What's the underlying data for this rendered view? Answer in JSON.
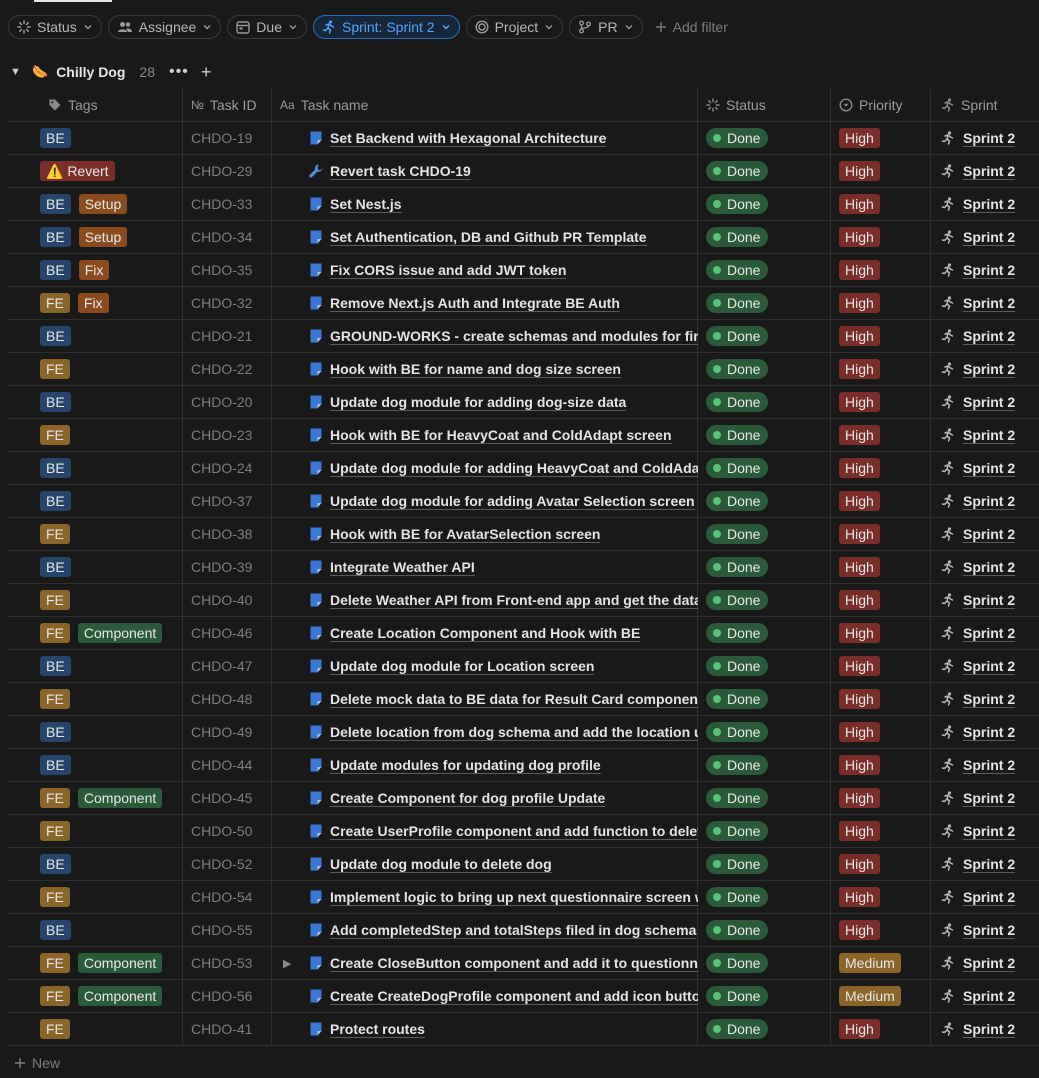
{
  "filters": {
    "status": "Status",
    "assignee": "Assignee",
    "due": "Due",
    "sprint": "Sprint: Sprint 2",
    "project": "Project",
    "pr": "PR",
    "add_filter": "Add filter"
  },
  "group": {
    "emoji": "🌭",
    "name": "Chilly Dog",
    "count": "28",
    "more": "•••",
    "add": "+"
  },
  "columns": {
    "tags": "Tags",
    "task_id": "Task ID",
    "task_id_prefix": "№",
    "task_name": "Task name",
    "task_name_prefix": "Aa",
    "status": "Status",
    "priority": "Priority",
    "sprint": "Sprint"
  },
  "rows": [
    {
      "tags": [
        "BE"
      ],
      "id": "CHDO-19",
      "name": "Set Backend with Hexagonal Architecture",
      "icon": "task",
      "status": "Done",
      "priority": "High",
      "sprint": "Sprint 2"
    },
    {
      "tags": [
        "⚠️ Revert"
      ],
      "id": "CHDO-29",
      "name": "Revert task CHDO-19",
      "icon": "wrench",
      "status": "Done",
      "priority": "High",
      "sprint": "Sprint 2"
    },
    {
      "tags": [
        "BE",
        "Setup"
      ],
      "id": "CHDO-33",
      "name": "Set Nest.js",
      "icon": "task",
      "status": "Done",
      "priority": "High",
      "sprint": "Sprint 2"
    },
    {
      "tags": [
        "BE",
        "Setup"
      ],
      "id": "CHDO-34",
      "name": "Set Authentication, DB and Github PR Template",
      "icon": "task",
      "status": "Done",
      "priority": "High",
      "sprint": "Sprint 2"
    },
    {
      "tags": [
        "BE",
        "Fix"
      ],
      "id": "CHDO-35",
      "name": "Fix CORS issue and add JWT token",
      "icon": "task",
      "status": "Done",
      "priority": "High",
      "sprint": "Sprint 2"
    },
    {
      "tags": [
        "FE",
        "Fix"
      ],
      "id": "CHDO-32",
      "name": "Remove Next.js Auth and Integrate BE Auth",
      "icon": "task",
      "status": "Done",
      "priority": "High",
      "sprint": "Sprint 2"
    },
    {
      "tags": [
        "BE"
      ],
      "id": "CHDO-21",
      "name": "GROUND-WORKS - create schemas and modules for firs",
      "icon": "task",
      "status": "Done",
      "priority": "High",
      "sprint": "Sprint 2"
    },
    {
      "tags": [
        "FE"
      ],
      "id": "CHDO-22",
      "name": "Hook with BE for name and dog size screen",
      "icon": "task",
      "status": "Done",
      "priority": "High",
      "sprint": "Sprint 2"
    },
    {
      "tags": [
        "BE"
      ],
      "id": "CHDO-20",
      "name": "Update dog module for adding dog-size data",
      "icon": "task",
      "status": "Done",
      "priority": "High",
      "sprint": "Sprint 2"
    },
    {
      "tags": [
        "FE"
      ],
      "id": "CHDO-23",
      "name": "Hook with BE for HeavyCoat and ColdAdapt screen",
      "icon": "task",
      "status": "Done",
      "priority": "High",
      "sprint": "Sprint 2"
    },
    {
      "tags": [
        "BE"
      ],
      "id": "CHDO-24",
      "name": "Update dog module for adding HeavyCoat and ColdAda",
      "icon": "task",
      "status": "Done",
      "priority": "High",
      "sprint": "Sprint 2"
    },
    {
      "tags": [
        "BE"
      ],
      "id": "CHDO-37",
      "name": "Update dog module for adding Avatar Selection screen",
      "icon": "task",
      "status": "Done",
      "priority": "High",
      "sprint": "Sprint 2"
    },
    {
      "tags": [
        "FE"
      ],
      "id": "CHDO-38",
      "name": "Hook with BE for AvatarSelection screen",
      "icon": "task",
      "status": "Done",
      "priority": "High",
      "sprint": "Sprint 2"
    },
    {
      "tags": [
        "BE"
      ],
      "id": "CHDO-39",
      "name": "Integrate Weather API",
      "icon": "task",
      "status": "Done",
      "priority": "High",
      "sprint": "Sprint 2"
    },
    {
      "tags": [
        "FE"
      ],
      "id": "CHDO-40",
      "name": "Delete Weather API from Front-end app and get the data",
      "icon": "task",
      "status": "Done",
      "priority": "High",
      "sprint": "Sprint 2"
    },
    {
      "tags": [
        "FE",
        "Component"
      ],
      "id": "CHDO-46",
      "name": "Create Location Component and Hook with BE",
      "icon": "task",
      "status": "Done",
      "priority": "High",
      "sprint": "Sprint 2"
    },
    {
      "tags": [
        "BE"
      ],
      "id": "CHDO-47",
      "name": "Update dog module for Location screen",
      "icon": "task",
      "status": "Done",
      "priority": "High",
      "sprint": "Sprint 2"
    },
    {
      "tags": [
        "FE"
      ],
      "id": "CHDO-48",
      "name": "Delete mock data to BE data for Result Card component",
      "icon": "task",
      "status": "Done",
      "priority": "High",
      "sprint": "Sprint 2"
    },
    {
      "tags": [
        "BE"
      ],
      "id": "CHDO-49",
      "name": "Delete location from dog schema and add the location u",
      "icon": "task",
      "status": "Done",
      "priority": "High",
      "sprint": "Sprint 2"
    },
    {
      "tags": [
        "BE"
      ],
      "id": "CHDO-44",
      "name": "Update modules for updating dog profile",
      "icon": "task",
      "status": "Done",
      "priority": "High",
      "sprint": "Sprint 2"
    },
    {
      "tags": [
        "FE",
        "Component"
      ],
      "id": "CHDO-45",
      "name": "Create Component for dog profile Update",
      "icon": "task",
      "status": "Done",
      "priority": "High",
      "sprint": "Sprint 2"
    },
    {
      "tags": [
        "FE"
      ],
      "id": "CHDO-50",
      "name": "Create UserProfile component and add function to delet",
      "icon": "task",
      "status": "Done",
      "priority": "High",
      "sprint": "Sprint 2"
    },
    {
      "tags": [
        "BE"
      ],
      "id": "CHDO-52",
      "name": "Update dog module to delete dog",
      "icon": "task",
      "status": "Done",
      "priority": "High",
      "sprint": "Sprint 2"
    },
    {
      "tags": [
        "FE"
      ],
      "id": "CHDO-54",
      "name": "Implement logic to bring up next questionnaire screen w",
      "icon": "task",
      "status": "Done",
      "priority": "High",
      "sprint": "Sprint 2"
    },
    {
      "tags": [
        "BE"
      ],
      "id": "CHDO-55",
      "name": "Add completedStep and totalSteps filed in dog schema",
      "icon": "task",
      "status": "Done",
      "priority": "High",
      "sprint": "Sprint 2"
    },
    {
      "tags": [
        "FE",
        "Component"
      ],
      "id": "CHDO-53",
      "name": "Create CloseButton component and add it to questionna",
      "icon": "task",
      "expand": "▶",
      "status": "Done",
      "priority": "Medium",
      "sprint": "Sprint 2"
    },
    {
      "tags": [
        "FE",
        "Component"
      ],
      "id": "CHDO-56",
      "name": "Create CreateDogProfile component and add icon butto",
      "icon": "task",
      "status": "Done",
      "priority": "Medium",
      "sprint": "Sprint 2"
    },
    {
      "tags": [
        "FE"
      ],
      "id": "CHDO-41",
      "name": "Protect routes",
      "icon": "task",
      "status": "Done",
      "priority": "High",
      "sprint": "Sprint 2"
    }
  ],
  "footer": {
    "new_label": "New"
  },
  "colors": {
    "background": "#191919",
    "accent": "#4fa3ff",
    "done": "#56c27b",
    "high": "#7a2e2a",
    "medium": "#8a6428"
  }
}
